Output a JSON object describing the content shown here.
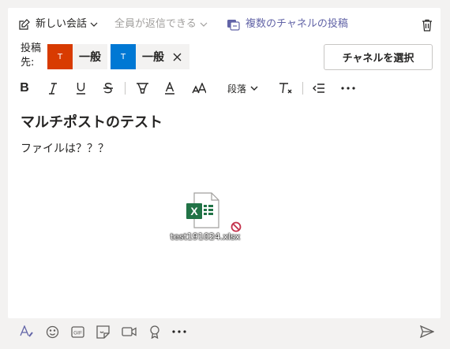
{
  "header": {
    "new_conversation": "新しい会話",
    "reply_setting": "全員が返信できる",
    "multi_channel": "複数のチャネルの投稿"
  },
  "post_to": {
    "label_line1": "投稿",
    "label_line2": "先:",
    "channels": [
      {
        "team_initial": "T",
        "name": "一般",
        "color": "#d83b01"
      },
      {
        "team_initial": "T",
        "name": "一般",
        "color": "#0078d4"
      }
    ],
    "select_button": "チャネルを選択"
  },
  "toolbar": {
    "paragraph": "段落"
  },
  "message": {
    "subject": "マルチポストのテスト",
    "body": "ファイルは？？？"
  },
  "attachment": {
    "filename": "test191024.xlsx",
    "icon_letter": "X"
  },
  "colors": {
    "accent": "#6264a7",
    "excel_green": "#217346",
    "blocked": "#c4314b"
  }
}
